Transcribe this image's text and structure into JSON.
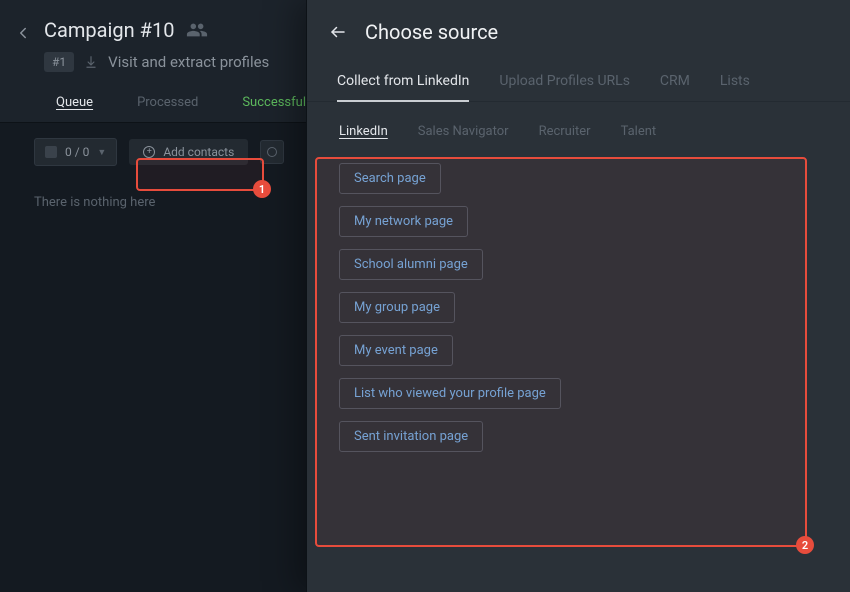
{
  "campaign": {
    "title": "Campaign #10",
    "badge": "#1",
    "subtitle": "Visit and extract profiles"
  },
  "tabs": {
    "queue": "Queue",
    "processed": "Processed",
    "successful": "Successful"
  },
  "toolbar": {
    "count": "0 / 0",
    "add_contacts": "Add contacts"
  },
  "empty": "There is nothing here",
  "panel": {
    "title": "Choose source",
    "tabs": {
      "collect": "Collect from LinkedIn",
      "upload": "Upload Profiles URLs",
      "crm": "CRM",
      "lists": "Lists"
    },
    "subtabs": {
      "linkedin": "LinkedIn",
      "sales": "Sales Navigator",
      "recruiter": "Recruiter",
      "talent": "Talent"
    },
    "options": {
      "search": "Search page",
      "network": "My network page",
      "alumni": "School alumni page",
      "group": "My group page",
      "event": "My event page",
      "viewed": "List who viewed your profile page",
      "sent": "Sent invitation page"
    }
  },
  "callouts": {
    "one": "1",
    "two": "2"
  }
}
